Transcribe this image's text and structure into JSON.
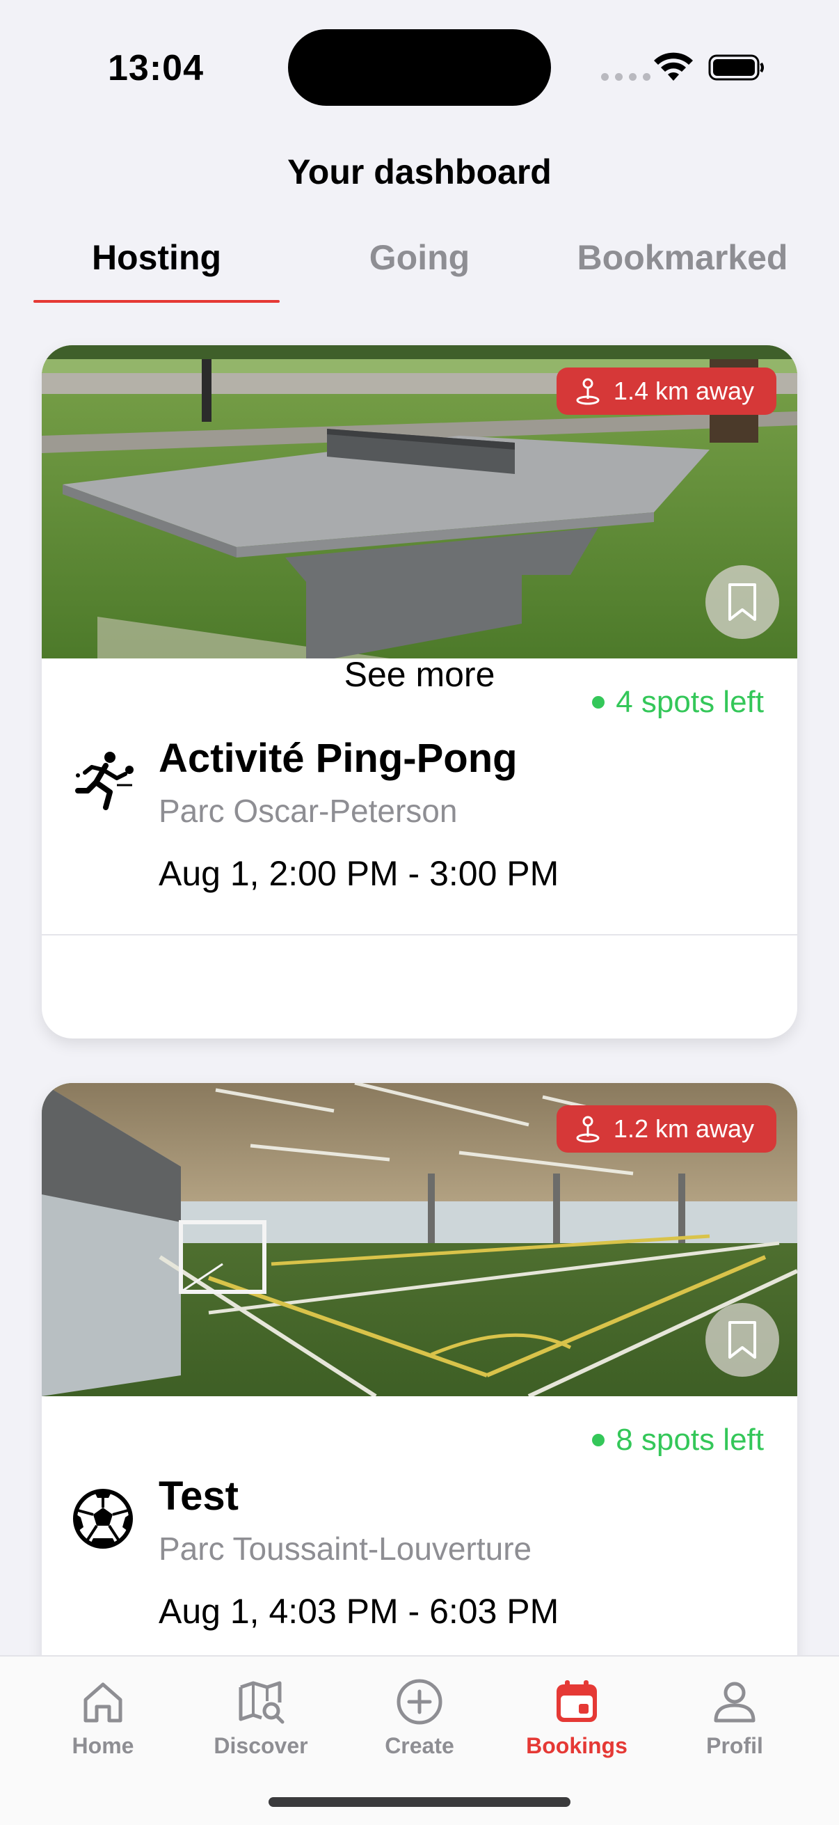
{
  "status_bar": {
    "time": "13:04"
  },
  "header": {
    "title": "Your dashboard"
  },
  "tabs": [
    {
      "label": "Hosting",
      "active": true
    },
    {
      "label": "Going",
      "active": false
    },
    {
      "label": "Bookmarked",
      "active": false
    }
  ],
  "events": [
    {
      "title": "Activité Ping-Pong",
      "location": "Parc Oscar-Peterson",
      "time": "Aug 1, 2:00 PM - 3:00 PM",
      "distance": "1.4 km away",
      "spots": "4 spots left",
      "sport_icon": "ping-pong-player-icon",
      "see_more": "See more"
    },
    {
      "title": "Test",
      "location": "Parc Toussaint-Louverture",
      "time": "Aug 1, 4:03 PM - 6:03 PM",
      "distance": "1.2 km away",
      "spots": "8 spots left",
      "sport_icon": "soccer-ball-icon"
    }
  ],
  "tab_bar": [
    {
      "label": "Home",
      "icon": "house-icon",
      "active": false
    },
    {
      "label": "Discover",
      "icon": "map-search-icon",
      "active": false
    },
    {
      "label": "Create",
      "icon": "plus-circle-icon",
      "active": false
    },
    {
      "label": "Bookings",
      "icon": "calendar-icon",
      "active": true
    },
    {
      "label": "Profil",
      "icon": "person-icon",
      "active": false
    }
  ],
  "colors": {
    "accent": "#e53935",
    "badge": "#d63838",
    "available": "#34c759",
    "inactive": "#8e8e93",
    "background": "#f2f2f7"
  }
}
